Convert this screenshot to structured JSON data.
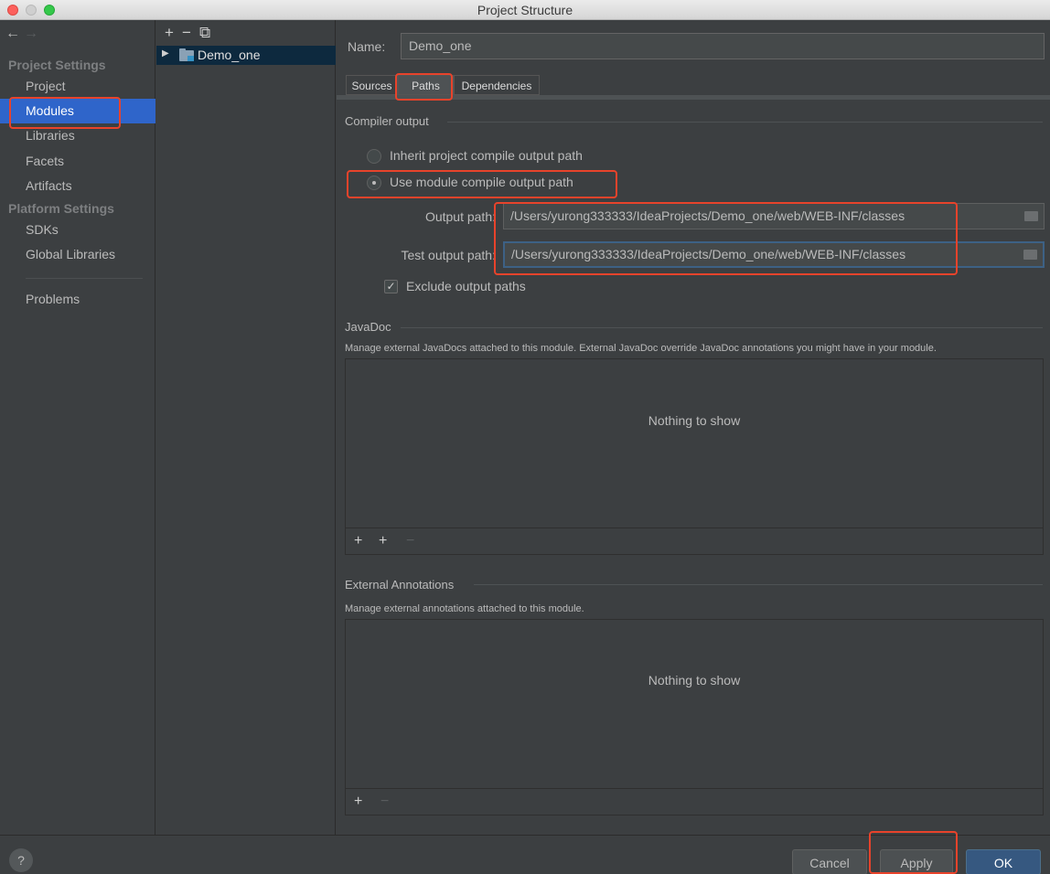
{
  "window": {
    "title": "Project Structure"
  },
  "nav": {
    "back_icon": "←",
    "forward_icon": "→"
  },
  "sidebar": {
    "project_settings_header": "Project Settings",
    "platform_settings_header": "Platform Settings",
    "items": [
      {
        "label": "Project"
      },
      {
        "label": "Modules",
        "selected": true
      },
      {
        "label": "Libraries"
      },
      {
        "label": "Facets"
      },
      {
        "label": "Artifacts"
      },
      {
        "label": "SDKs"
      },
      {
        "label": "Global Libraries"
      },
      {
        "label": "Problems"
      }
    ]
  },
  "tree": {
    "toolbar": {
      "add": "+",
      "remove": "−",
      "copy": "⧉"
    },
    "module_name": "Demo_one"
  },
  "module": {
    "name_label": "Name:",
    "name_value": "Demo_one",
    "tabs": [
      {
        "label": "Sources"
      },
      {
        "label": "Paths",
        "active": true
      },
      {
        "label": "Dependencies"
      }
    ]
  },
  "compiler_output": {
    "title": "Compiler output",
    "inherit_label": "Inherit project compile output path",
    "use_module_label": "Use module compile output path",
    "selected": "use_module",
    "output_path_label": "Output path:",
    "output_path_value": "/Users/yurong333333/IdeaProjects/Demo_one/web/WEB-INF/classes",
    "test_output_path_label": "Test output path:",
    "test_output_path_value": "/Users/yurong333333/IdeaProjects/Demo_one/web/WEB-INF/classes",
    "exclude_label": "Exclude output paths",
    "exclude_checked": true
  },
  "javadoc": {
    "title": "JavaDoc",
    "description": "Manage external JavaDocs attached to this module. External JavaDoc override JavaDoc annotations you might have in your module.",
    "empty_text": "Nothing to show",
    "toolbar": {
      "add": "+",
      "add_url": "+",
      "remove": "−"
    }
  },
  "external_annotations": {
    "title": "External Annotations",
    "description": "Manage external annotations attached to this module.",
    "empty_text": "Nothing to show",
    "toolbar": {
      "add": "+",
      "remove": "−"
    }
  },
  "footer": {
    "help": "?",
    "cancel": "Cancel",
    "apply": "Apply",
    "ok": "OK"
  },
  "colors": {
    "accent_selection": "#2f65ca",
    "annotation_red": "#e8432b",
    "primary_button": "#365880"
  }
}
